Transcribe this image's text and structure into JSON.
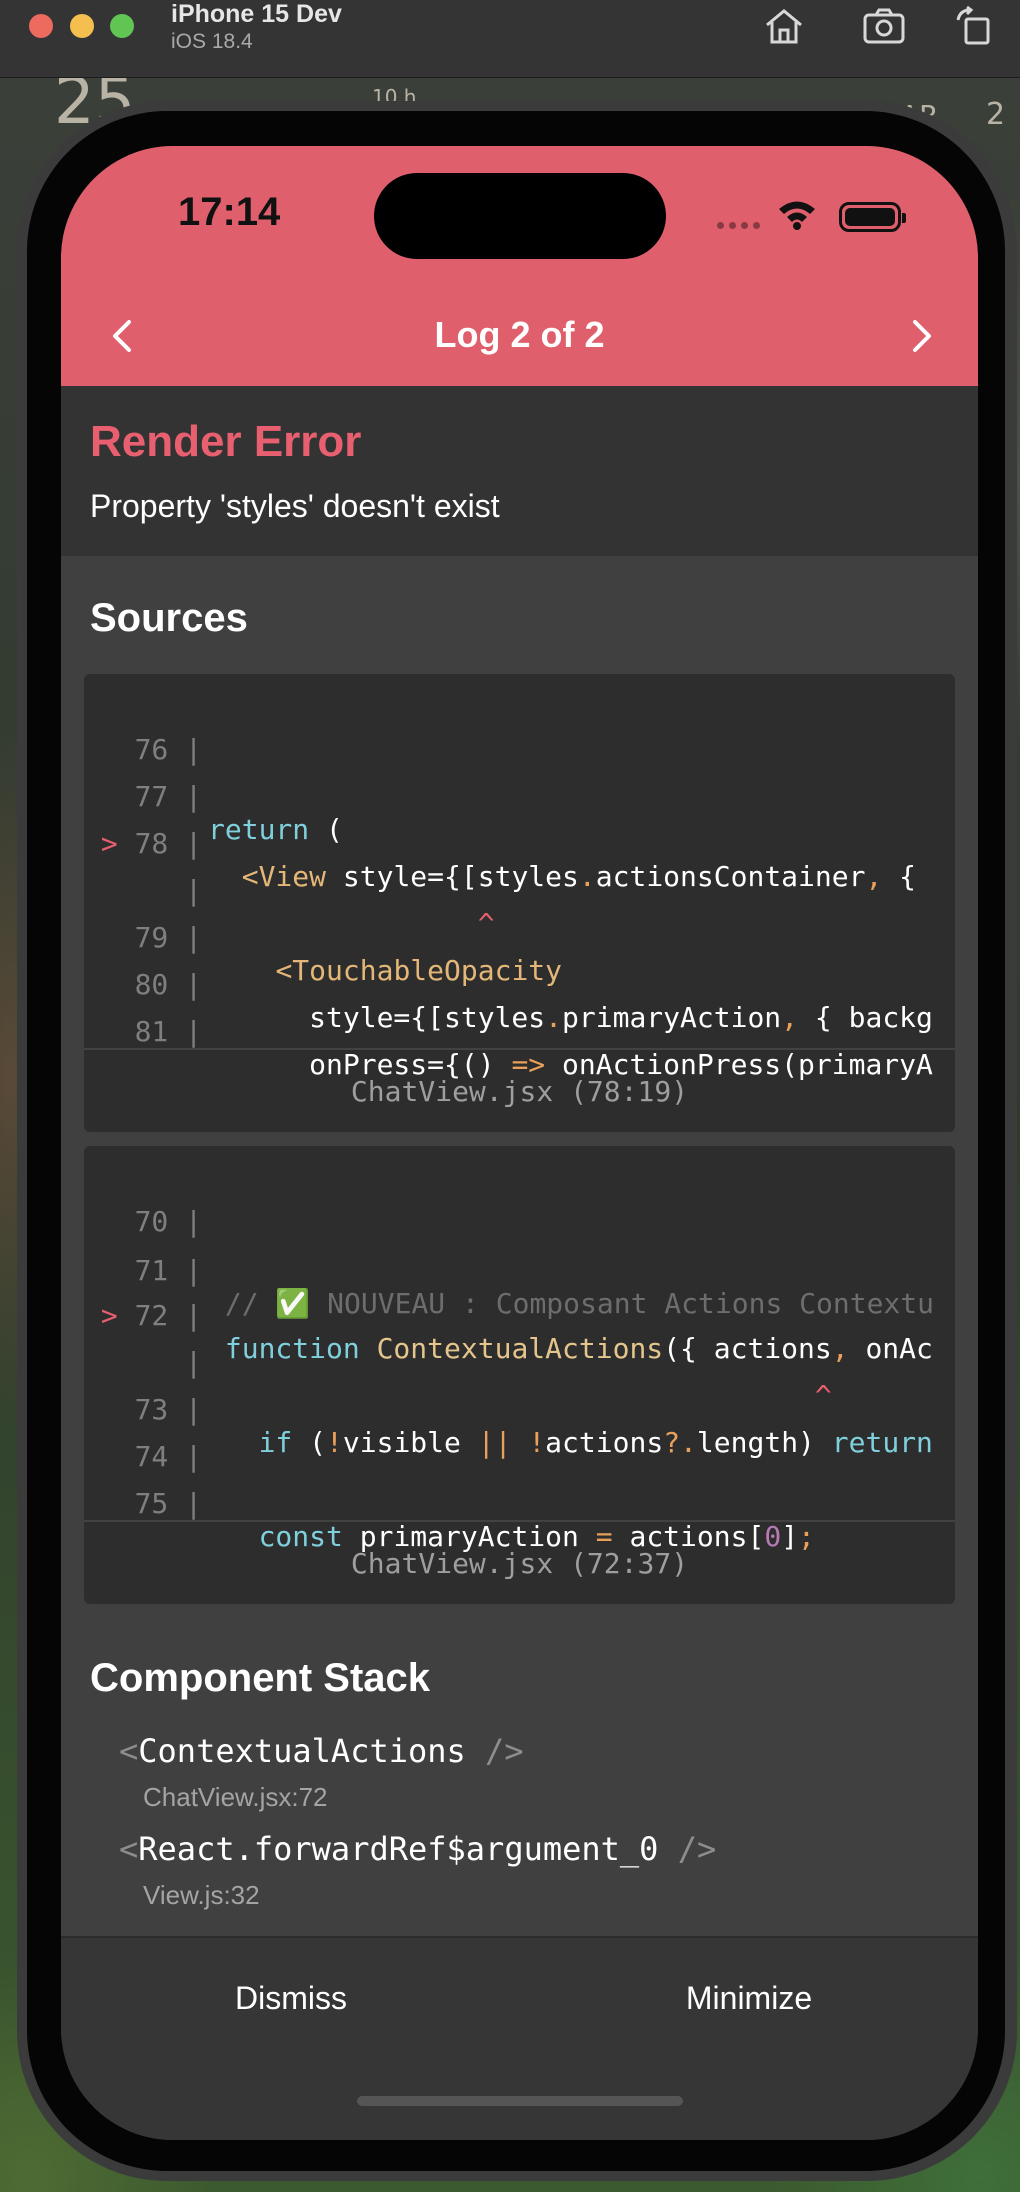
{
  "simulator": {
    "device_name": "iPhone 15 Dev",
    "os_version": "iOS 18.4",
    "toolbar_icons": [
      "home-icon",
      "screenshot-icon",
      "rotate-icon"
    ]
  },
  "wallpaper": {
    "clock_digits": "25",
    "label_a": "10 h",
    "label_b": "AR",
    "label_c": "2"
  },
  "status_bar": {
    "time": "17:14"
  },
  "header": {
    "title": "Log 2 of 2",
    "prev_icon": "chevron-left-icon",
    "next_icon": "chevron-right-icon",
    "color": "#e05f6d"
  },
  "error": {
    "title": "Render Error",
    "message": "Property 'styles' doesn't exist",
    "color": "#e86070"
  },
  "sources": {
    "title": "Sources",
    "frames": [
      {
        "file": "ChatView.jsx (78:19)",
        "lines": [
          {
            "gutter": "76",
            "code": ""
          },
          {
            "gutter": "77",
            "code": "return ("
          },
          {
            "gutter": "78",
            "code": "  <View style={[styles.actionsContainer, {"
          },
          {
            "gutter": "",
            "code": "                ^"
          },
          {
            "gutter": "79",
            "code": "    <TouchableOpacity"
          },
          {
            "gutter": "80",
            "code": "      style={[styles.primaryAction, { backg"
          },
          {
            "gutter": "81",
            "code": "      onPress={() => onActionPress(primaryA"
          }
        ]
      },
      {
        "file": "ChatView.jsx (72:37)",
        "lines": [
          {
            "gutter": "70",
            "code": ""
          },
          {
            "gutter": "71",
            "code": "// ✅ NOUVEAU : Composant Actions Contextu"
          },
          {
            "gutter": "72",
            "code": "function ContextualActions({ actions, onAc"
          },
          {
            "gutter": "",
            "code": "                                    ^"
          },
          {
            "gutter": "73",
            "code": "  if (!visible || !actions?.length) return"
          },
          {
            "gutter": "74",
            "code": ""
          },
          {
            "gutter": "75",
            "code": "  const primaryAction = actions[0];"
          }
        ]
      }
    ]
  },
  "component_stack": {
    "title": "Component Stack",
    "items": [
      {
        "name": "ContextualActions",
        "file": "ChatView.jsx:72"
      },
      {
        "name": "React.forwardRef$argument_0",
        "file": "View.js:32"
      }
    ]
  },
  "footer": {
    "dismiss_label": "Dismiss",
    "minimize_label": "Minimize"
  }
}
